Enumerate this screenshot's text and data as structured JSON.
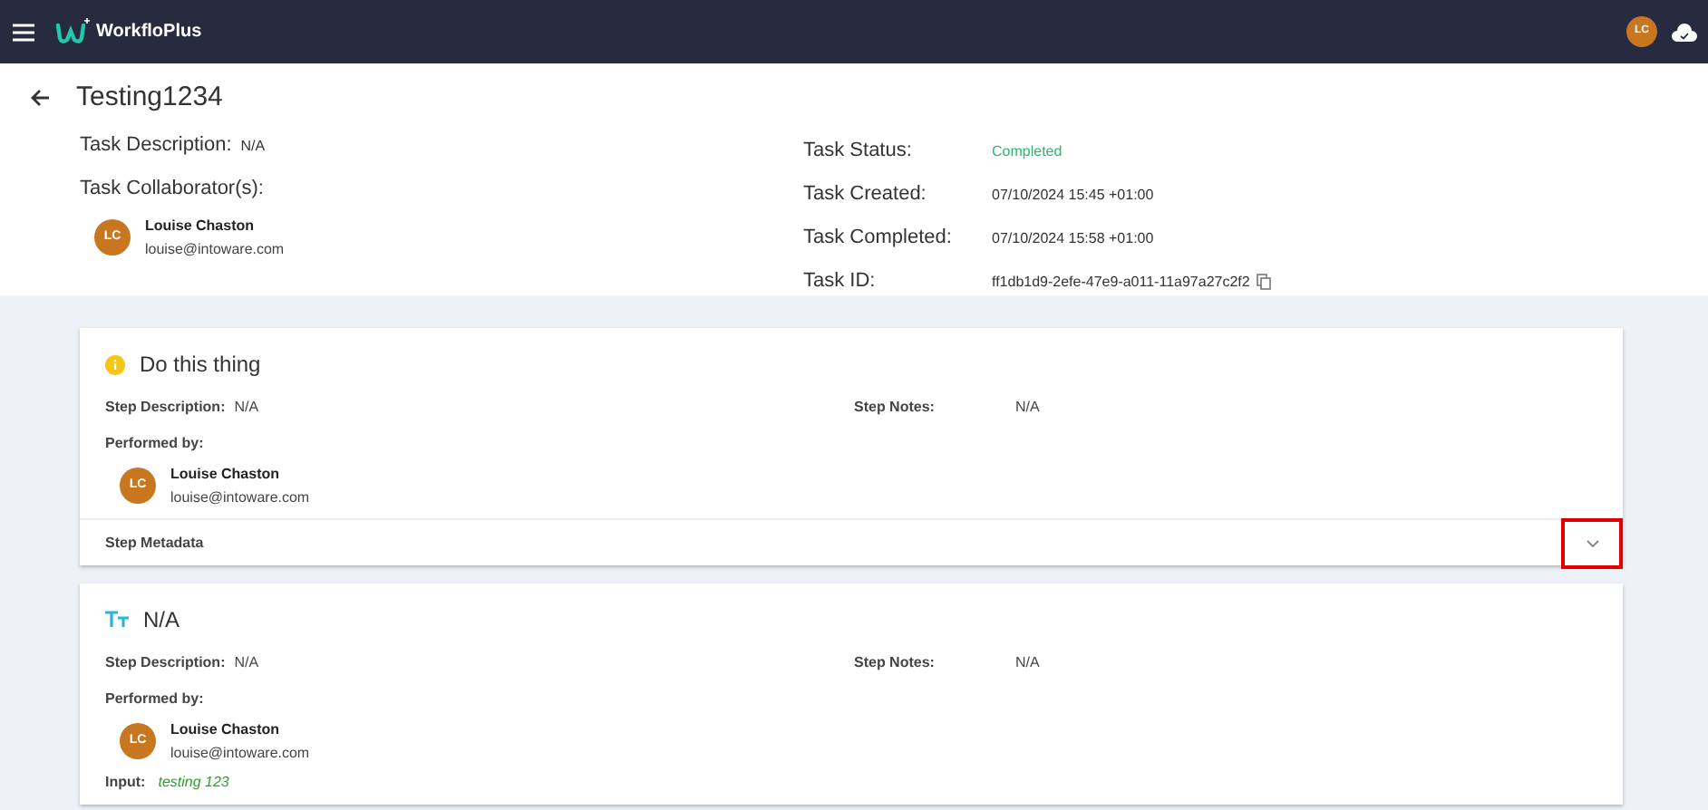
{
  "app_bar": {
    "brand": "WorkfloPlus",
    "user_initials": "LC"
  },
  "task": {
    "title": "Testing1234",
    "description_label": "Task Description:",
    "description": "N/A",
    "collaborators_label": "Task Collaborator(s):",
    "collaborators": [
      {
        "initials": "LC",
        "name": "Louise Chaston",
        "email": "louise@intoware.com"
      }
    ],
    "details": [
      {
        "label": "Task Status:",
        "value": "Completed",
        "kind": "status"
      },
      {
        "label": "Task Created:",
        "value": "07/10/2024 15:45 +01:00",
        "kind": "text"
      },
      {
        "label": "Task Completed:",
        "value": "07/10/2024 15:58 +01:00",
        "kind": "text"
      },
      {
        "label": "Task ID:",
        "value": "ff1db1d9-2efe-47e9-a011-11a97a27c2f2",
        "kind": "id"
      }
    ]
  },
  "steps": [
    {
      "kind": "info",
      "title": "Do this thing",
      "description_label": "Step Description:",
      "description": "N/A",
      "notes_label": "Step Notes:",
      "notes": "N/A",
      "performed_label": "Performed by:",
      "performer": {
        "initials": "LC",
        "name": "Louise Chaston",
        "email": "louise@intoware.com"
      },
      "metadata_label": "Step Metadata",
      "metadata_expanded": false,
      "metadata_highlighted": true
    },
    {
      "kind": "text",
      "title": "N/A",
      "description_label": "Step Description:",
      "description": "N/A",
      "notes_label": "Step Notes:",
      "notes": "N/A",
      "performed_label": "Performed by:",
      "performer": {
        "initials": "LC",
        "name": "Louise Chaston",
        "email": "louise@intoware.com"
      },
      "input_label": "Input:",
      "input": "testing 123"
    }
  ]
}
